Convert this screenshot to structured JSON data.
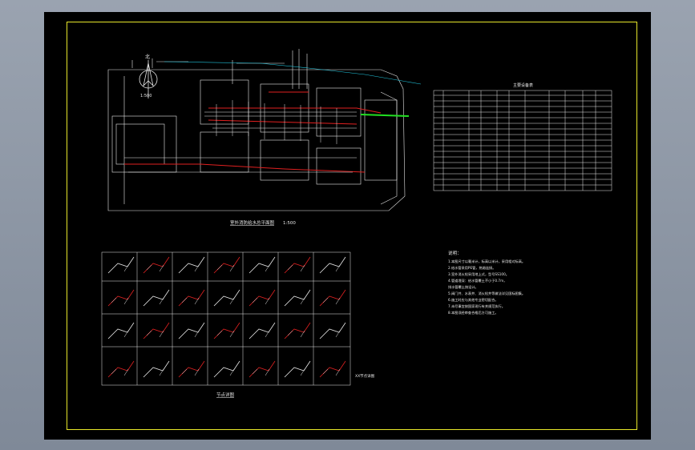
{
  "drawing": {
    "site_plan_title": "室外消防给水总平面图",
    "site_plan_scale": "1:500",
    "north_label": "北",
    "north_scale": "1:500",
    "table_title": "主要设备表",
    "notes_title": "说明：",
    "notes": [
      "1.本图尺寸以毫米计，标高以米计，采用相对标高。",
      "2.给水管采用PE管，热熔连接。",
      "3.室外消火栓采用地上式，型号SS100。",
      "4.管道埋深：给水管覆土不小于0.7m，",
      "   排水管覆土按设计。",
      "5.阀门井、水表井、消火栓井等做法详见国标图集。",
      "6.施工时应与其他专业密切配合。",
      "7.未尽事宜按国家现行有关规范执行。",
      "8.本图须经审查合格后方可施工。"
    ],
    "details_title": "节点详图",
    "detail_last_label": "XX节点详图",
    "colors": {
      "border": "#e6e62a",
      "background": "#000000",
      "pipe_red": "#e02020",
      "pipe_green": "#22e022",
      "pipe_cyan": "#22c8e0",
      "lines": "#e8e8e8"
    }
  }
}
